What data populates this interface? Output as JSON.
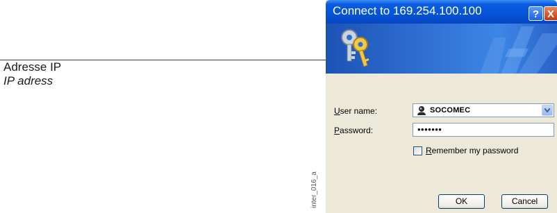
{
  "annotation": {
    "label_fr": "Adresse IP",
    "label_en": "IP adress"
  },
  "figure_code": "inter_016_a",
  "dialog": {
    "title": "Connect to 169.254.100.100",
    "help_label": "?",
    "close_label": "X",
    "form": {
      "user_label_accel": "U",
      "user_label_rest": "ser name:",
      "user_value": "SOCOMEC",
      "password_label_accel": "P",
      "password_label_rest": "assword:",
      "password_value": "•••••••",
      "remember_accel": "R",
      "remember_rest": "emember my password",
      "remember_checked": false
    },
    "buttons": {
      "ok": "OK",
      "cancel": "Cancel"
    },
    "colors": {
      "titlebar": "#0553d8",
      "banner": "#2e6ed0",
      "body": "#ece9d8"
    }
  }
}
